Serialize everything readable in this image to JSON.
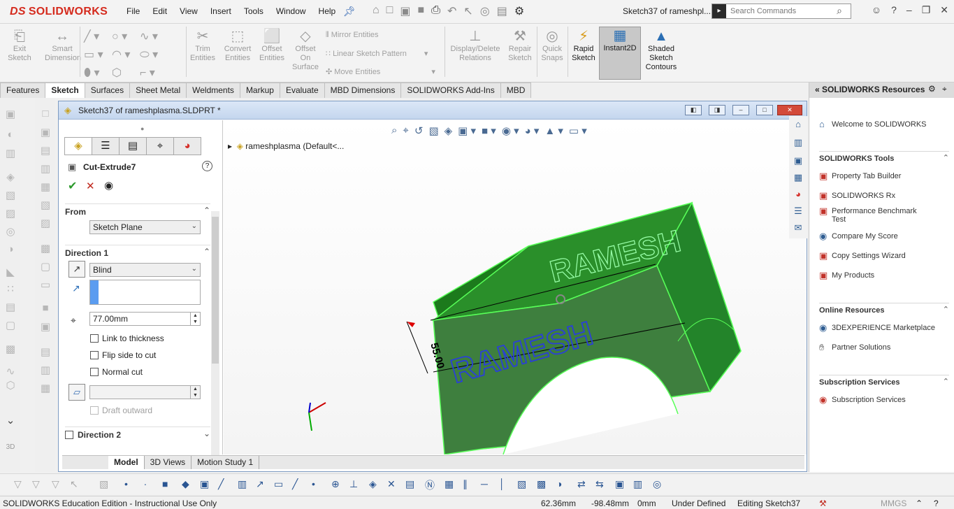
{
  "app": {
    "brand": "SOLIDWORKS",
    "brand_prefix": "DS",
    "brand_color": "#d52b1e"
  },
  "menu": [
    "File",
    "Edit",
    "View",
    "Insert",
    "Tools",
    "Window",
    "Help"
  ],
  "title_bar": {
    "doc_title": "Sketch37 of rameshpl...",
    "search_placeholder": "Search Commands"
  },
  "command_manager": {
    "tools": {
      "exit_sketch": "Exit\nSketch",
      "smart_dimension": "Smart\nDimension",
      "trim_entities": "Trim\nEntities",
      "convert_entities": "Convert\nEntities",
      "offset_entities": "Offset\nEntities",
      "offset_on_surface": "Offset\nOn\nSurface",
      "mirror_entities": "Mirror Entities",
      "linear_sketch_pattern": "Linear Sketch Pattern",
      "move_entities": "Move Entities",
      "display_delete_relations": "Display/Delete\nRelations",
      "repair_sketch": "Repair\nSketch",
      "quick_snaps": "Quick\nSnaps",
      "rapid_sketch": "Rapid\nSketch",
      "instant2d": "Instant2D",
      "shaded_sketch_contours": "Shaded\nSketch\nContours"
    }
  },
  "tabs": [
    "Features",
    "Sketch",
    "Surfaces",
    "Sheet Metal",
    "Weldments",
    "Markup",
    "Evaluate",
    "MBD Dimensions",
    "SOLIDWORKS Add-Ins",
    "MBD"
  ],
  "active_tab": "Sketch",
  "document": {
    "title": "Sketch37 of rameshplasma.SLDPRT *"
  },
  "property_manager": {
    "feature_name": "Cut-Extrude7",
    "from": {
      "header": "From",
      "value": "Sketch Plane"
    },
    "direction1": {
      "header": "Direction 1",
      "end_condition": "Blind",
      "depth": "77.00mm"
    },
    "checkboxes": {
      "link_thickness": "Link to thickness",
      "flip_side": "Flip side to cut",
      "normal_cut": "Normal cut",
      "draft_outward": "Draft outward"
    },
    "direction2": {
      "header": "Direction 2"
    }
  },
  "tree": {
    "root": "rameshplasma  (Default<..."
  },
  "model": {
    "text": "RAMESH",
    "dimension": "55.00",
    "color": "#2ea52e"
  },
  "bottom_tabs": [
    "Model",
    "3D Views",
    "Motion Study 1"
  ],
  "task_pane": {
    "header": "SOLIDWORKS Resources",
    "welcome": "Welcome to SOLIDWORKS",
    "sections": [
      {
        "title": "SOLIDWORKS Tools",
        "items": [
          "Property Tab Builder",
          "SOLIDWORKS Rx",
          "Performance Benchmark\nTest",
          "Compare My Score",
          "Copy Settings Wizard",
          "My Products"
        ]
      },
      {
        "title": "Online Resources",
        "items": [
          "3DEXPERIENCE Marketplace",
          "Partner Solutions"
        ]
      },
      {
        "title": "Subscription Services",
        "items": [
          "Subscription Services"
        ]
      }
    ]
  },
  "status_bar": {
    "edition": "SOLIDWORKS Education Edition - Instructional Use Only",
    "x": "62.36mm",
    "y": "-98.48mm",
    "z": "0mm",
    "state": "Under Defined",
    "editing": "Editing Sketch37",
    "units": "MMGS"
  }
}
